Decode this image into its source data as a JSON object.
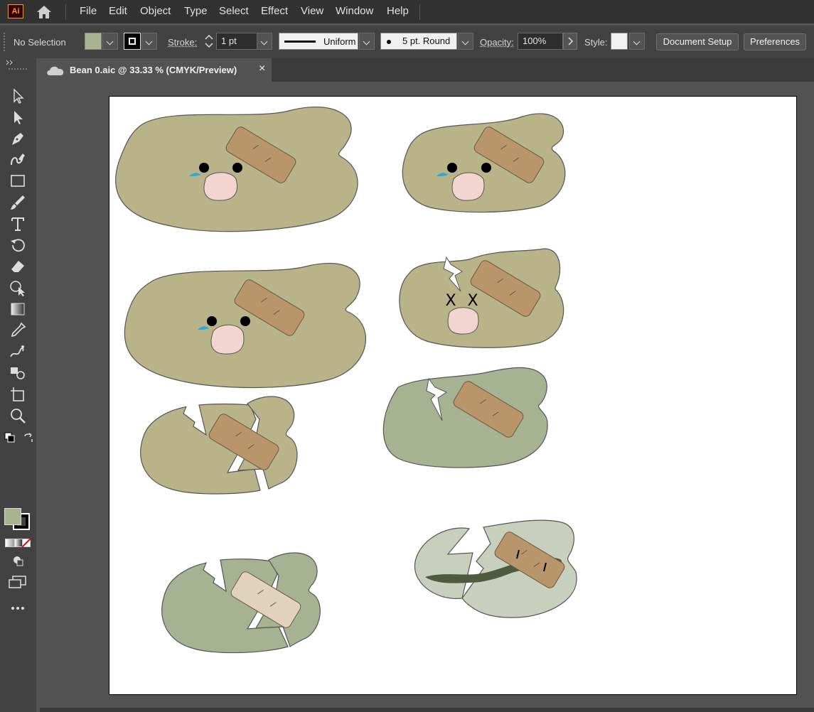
{
  "app": {
    "logo_text": "Ai"
  },
  "menu": [
    "File",
    "Edit",
    "Object",
    "Type",
    "Select",
    "Effect",
    "View",
    "Window",
    "Help"
  ],
  "control": {
    "selection": "No Selection",
    "stroke_label": "Stroke:",
    "stroke_weight": "1 pt",
    "profile": "Uniform",
    "brush": "5 pt. Round",
    "opacity_label": "Opacity:",
    "opacity": "100%",
    "style_label": "Style:",
    "document_setup": "Document Setup",
    "preferences": "Preferences",
    "fill_color": "#a9b291"
  },
  "tab": {
    "title": "Bean 0.aic @ 33.33 % (CMYK/Preview)",
    "close": "×"
  },
  "colors": {
    "bean_tan": "#b8b388",
    "bean_green": "#a6b292",
    "bean_pale": "#c9cfbd",
    "bandage": "#b8956b",
    "bandage_light": "#e0d2bd",
    "nose": "#f2d5cf",
    "tear": "#2da8d8"
  },
  "icons": [
    "home-icon",
    "selection-tool-icon",
    "direct-selection-tool-icon",
    "pen-tool-icon",
    "curvature-tool-icon",
    "rectangle-tool-icon",
    "paintbrush-tool-icon",
    "type-tool-icon",
    "rotate-tool-icon",
    "eraser-tool-icon",
    "shape-builder-tool-icon",
    "gradient-tool-icon",
    "eyedropper-tool-icon",
    "blend-tool-icon",
    "symbol-sprayer-tool-icon",
    "artboard-tool-icon",
    "zoom-tool-icon",
    "swap-colors-icon",
    "fill-swatch",
    "stroke-swatch",
    "color-mode-icon",
    "draw-mode-icon",
    "screen-mode-icon",
    "more-tools-icon"
  ],
  "art": {
    "x_mark_left": "X",
    "x_mark_right": "X"
  }
}
